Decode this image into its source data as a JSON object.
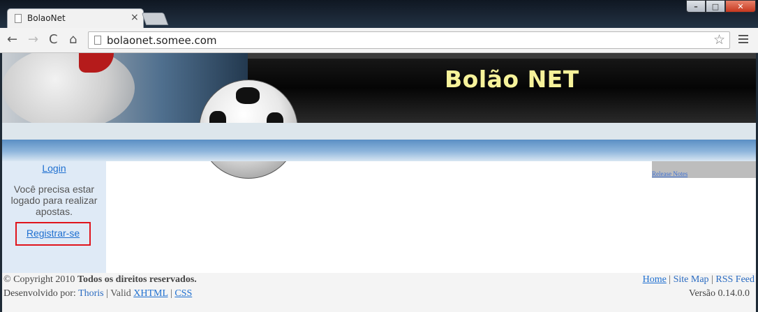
{
  "browser": {
    "tab_title": "BolaoNet",
    "tab_close": "×",
    "url": "bolaonet.somee.com",
    "win_min": "–",
    "win_max": "□",
    "win_close": "✕",
    "back": "←",
    "forward": "→",
    "reload": "C",
    "home": "⌂",
    "star": "☆"
  },
  "header": {
    "site_title": "Bolão NET"
  },
  "sidebar": {
    "login_label": "Login",
    "message": "Você precisa estar logado para realizar apostas.",
    "register_label": "Registrar-se"
  },
  "right_panel": {
    "release_notes": "Release Notes"
  },
  "footer": {
    "copyright_prefix": "© Copyright 2010",
    "copyright_bold": "Todos os direitos reservados.",
    "dev_prefix": "Desenvolvido por:",
    "dev_name": "Thoris",
    "valid_label": "| Valid",
    "xhtml": "XHTML",
    "sep": "|",
    "css": "CSS",
    "links": {
      "home": "Home",
      "sitemap": "Site Map",
      "rss": "RSS Feed"
    },
    "version": "Versão 0.14.0.0"
  },
  "colors": {
    "title_yellow": "#f6f29a",
    "link_blue": "#1e6fd0",
    "highlight_red": "#e0141c",
    "sidebar_bg": "#dfeaf6"
  }
}
